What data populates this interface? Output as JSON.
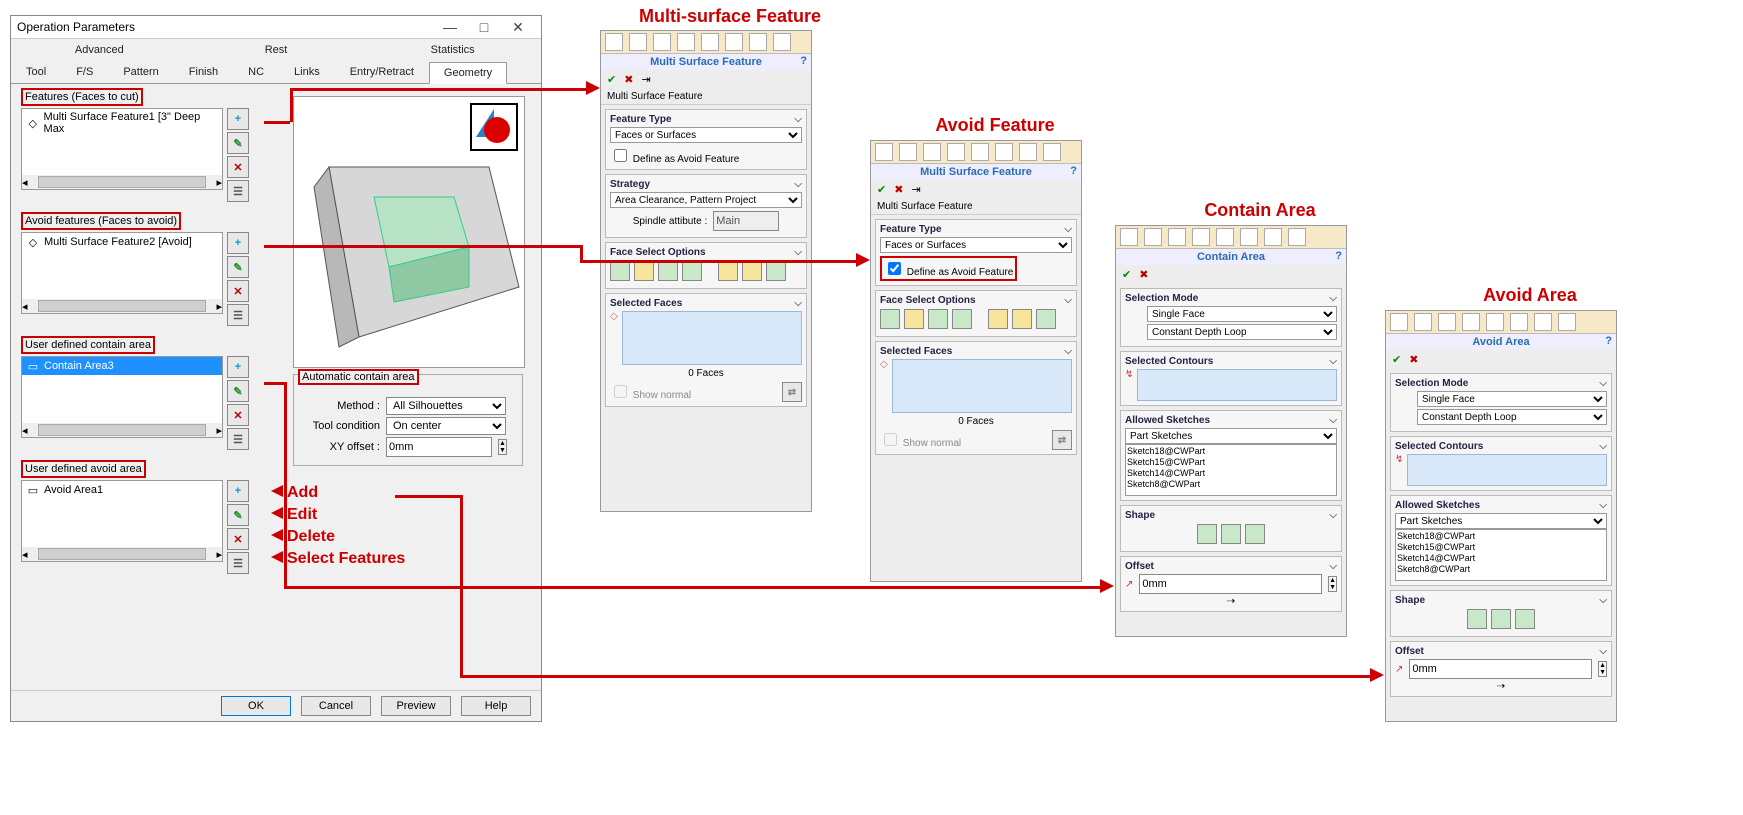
{
  "op": {
    "title": "Operation Parameters",
    "topTabs": {
      "advanced": "Advanced",
      "rest": "Rest",
      "statistics": "Statistics"
    },
    "tabs": {
      "tool": "Tool",
      "fs": "F/S",
      "pattern": "Pattern",
      "finish": "Finish",
      "nc": "NC",
      "links": "Links",
      "entry": "Entry/Retract",
      "geometry": "Geometry"
    },
    "sections": {
      "features": "Features (Faces to cut)",
      "avoidFeatures": "Avoid features (Faces to avoid)",
      "userContain": "User defined contain area",
      "userAvoid": "User defined avoid area",
      "autoContain": "Automatic contain area"
    },
    "items": {
      "msf1": "Multi Surface Feature1 [3\" Deep Max",
      "msf2": "Multi Surface Feature2 [Avoid]",
      "contain3": "Contain Area3",
      "avoid1": "Avoid Area1"
    },
    "auto": {
      "methodLbl": "Method :",
      "method": "All Silhouettes",
      "tcLbl": "Tool condition",
      "tc": "On center",
      "xyLbl": "XY offset :",
      "xy": "0mm"
    },
    "btns": {
      "ok": "OK",
      "cancel": "Cancel",
      "preview": "Preview",
      "help": "Help"
    }
  },
  "legend": {
    "add": "Add",
    "edit": "Edit",
    "delete": "Delete",
    "select": "Select Features"
  },
  "titles": {
    "msf": "Multi-surface Feature",
    "avoidF": "Avoid Feature",
    "contain": "Contain Area",
    "avoidA": "Avoid Area"
  },
  "pmCommon": {
    "ftype": "Feature Type",
    "ftypeV": "Faces or Surfaces",
    "defAvoid": "Define as Avoid Feature",
    "strategy": "Strategy",
    "strategyV": "Area Clearance, Pattern Project",
    "spindle": "Spindle attibute :",
    "spindleV": "Main",
    "fso": "Face Select Options",
    "selFaces": "Selected Faces",
    "faces0": "0 Faces",
    "show": "Show normal",
    "selMode": "Selection Mode",
    "single": "Single Face",
    "cdl": "Constant Depth Loop",
    "selContours": "Selected Contours",
    "allowed": "Allowed Sketches",
    "partSketches": "Part Sketches",
    "sketches": [
      "Sketch18@CWPart",
      "Sketch15@CWPart",
      "Sketch14@CWPart",
      "Sketch8@CWPart"
    ],
    "shape": "Shape",
    "offset": "Offset",
    "offV": "0mm"
  },
  "msfTitle": "Multi Surface Feature",
  "msfTag": "Multi Surface Feature",
  "containTitle": "Contain Area",
  "avoidTitle": "Avoid Area"
}
